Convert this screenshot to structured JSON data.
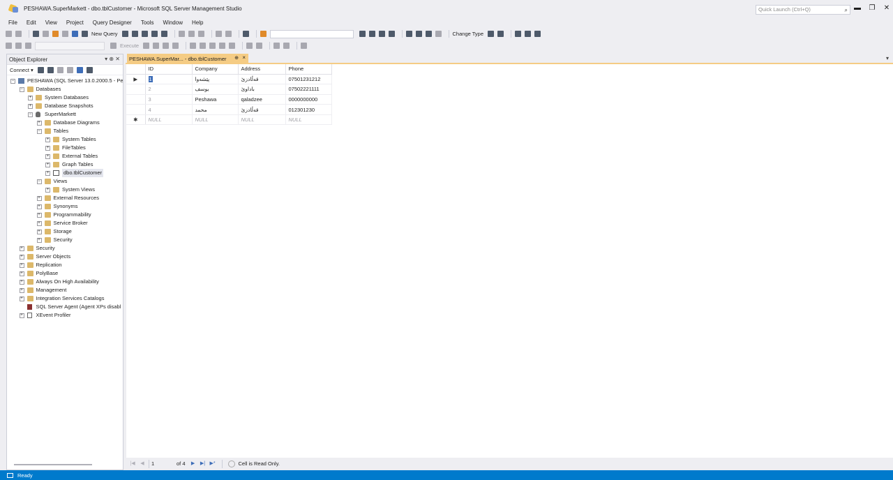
{
  "window": {
    "title": "PESHAWA.SuperMarkett - dbo.tblCustomer - Microsoft SQL Server Management Studio",
    "quick_launch_placeholder": "Quick Launch (Ctrl+Q)"
  },
  "menu": [
    "File",
    "Edit",
    "View",
    "Project",
    "Query Designer",
    "Tools",
    "Window",
    "Help"
  ],
  "toolbar": {
    "new_query": "New Query",
    "change_type": "Change Type",
    "execute": "Execute"
  },
  "object_explorer": {
    "title": "Object Explorer",
    "connect": "Connect",
    "tree": [
      {
        "label": "PESHAWA (SQL Server 13.0.2000.5 - Pe",
        "level": 0,
        "expander": "−",
        "icon": "server"
      },
      {
        "label": "Databases",
        "level": 1,
        "expander": "−",
        "icon": "folder"
      },
      {
        "label": "System Databases",
        "level": 2,
        "expander": "+",
        "icon": "folder"
      },
      {
        "label": "Database Snapshots",
        "level": 2,
        "expander": "+",
        "icon": "folder"
      },
      {
        "label": "SuperMarkett",
        "level": 2,
        "expander": "−",
        "icon": "db"
      },
      {
        "label": "Database Diagrams",
        "level": 3,
        "expander": "+",
        "icon": "folder"
      },
      {
        "label": "Tables",
        "level": 3,
        "expander": "−",
        "icon": "folder"
      },
      {
        "label": "System Tables",
        "level": 4,
        "expander": "+",
        "icon": "folder"
      },
      {
        "label": "FileTables",
        "level": 4,
        "expander": "+",
        "icon": "folder"
      },
      {
        "label": "External Tables",
        "level": 4,
        "expander": "+",
        "icon": "folder"
      },
      {
        "label": "Graph Tables",
        "level": 4,
        "expander": "+",
        "icon": "folder"
      },
      {
        "label": "dbo.tblCustomer",
        "level": 4,
        "expander": "+",
        "icon": "table",
        "selected": true
      },
      {
        "label": "Views",
        "level": 3,
        "expander": "−",
        "icon": "folder"
      },
      {
        "label": "System Views",
        "level": 4,
        "expander": "+",
        "icon": "folder"
      },
      {
        "label": "External Resources",
        "level": 3,
        "expander": "+",
        "icon": "folder"
      },
      {
        "label": "Synonyms",
        "level": 3,
        "expander": "+",
        "icon": "folder"
      },
      {
        "label": "Programmability",
        "level": 3,
        "expander": "+",
        "icon": "folder"
      },
      {
        "label": "Service Broker",
        "level": 3,
        "expander": "+",
        "icon": "folder"
      },
      {
        "label": "Storage",
        "level": 3,
        "expander": "+",
        "icon": "folder"
      },
      {
        "label": "Security",
        "level": 3,
        "expander": "+",
        "icon": "folder"
      },
      {
        "label": "Security",
        "level": 1,
        "expander": "+",
        "icon": "folder"
      },
      {
        "label": "Server Objects",
        "level": 1,
        "expander": "+",
        "icon": "folder"
      },
      {
        "label": "Replication",
        "level": 1,
        "expander": "+",
        "icon": "folder"
      },
      {
        "label": "PolyBase",
        "level": 1,
        "expander": "+",
        "icon": "folder"
      },
      {
        "label": "Always On High Availability",
        "level": 1,
        "expander": "+",
        "icon": "folder"
      },
      {
        "label": "Management",
        "level": 1,
        "expander": "+",
        "icon": "folder"
      },
      {
        "label": "Integration Services Catalogs",
        "level": 1,
        "expander": "+",
        "icon": "folder"
      },
      {
        "label": "SQL Server Agent (Agent XPs disabl",
        "level": 1,
        "expander": "",
        "icon": "agent"
      },
      {
        "label": "XEvent Profiler",
        "level": 1,
        "expander": "+",
        "icon": "xevent"
      }
    ]
  },
  "document": {
    "tab_label": "PESHAWA.SuperMar... - dbo.tblCustomer",
    "tab_pin": "⊕",
    "tab_close": "×"
  },
  "grid": {
    "columns": [
      "ID",
      "Company",
      "Address",
      "Phone"
    ],
    "rows": [
      {
        "marker": "▶",
        "id": "1",
        "company": "پێشەوا",
        "address": "قەڵادزێ",
        "phone": "07501231212",
        "current": true
      },
      {
        "marker": "",
        "id": "2",
        "company": "یوسف",
        "address": "باداوێ",
        "phone": "07502221111"
      },
      {
        "marker": "",
        "id": "3",
        "company": "Peshawa",
        "address": "qaladzee",
        "phone": "0000000000"
      },
      {
        "marker": "",
        "id": "4",
        "company": "محمد",
        "address": "قەڵادزێ",
        "phone": "012301230"
      }
    ],
    "new_row": {
      "marker": "✱",
      "id": "NULL",
      "company": "NULL",
      "address": "NULL",
      "phone": "NULL"
    }
  },
  "navigator": {
    "position": "1",
    "of_label": "of 4",
    "status": "Cell is Read Only."
  },
  "statusbar": {
    "text": "Ready"
  },
  "colors": {
    "accent": "#007acc",
    "tab_active": "#f5cc84"
  }
}
